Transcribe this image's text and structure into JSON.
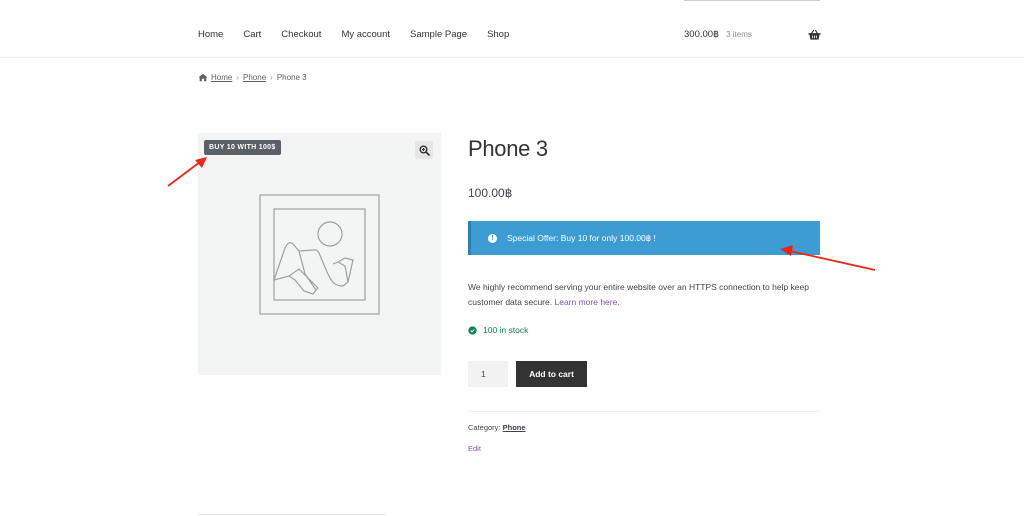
{
  "nav": {
    "items": [
      {
        "label": "Home"
      },
      {
        "label": "Cart"
      },
      {
        "label": "Checkout"
      },
      {
        "label": "My account"
      },
      {
        "label": "Sample Page"
      },
      {
        "label": "Shop"
      }
    ]
  },
  "cart": {
    "total": "300.00฿",
    "count": "3 items",
    "icon": "basket-icon"
  },
  "breadcrumb": {
    "home_icon": "home-icon",
    "home": "Home",
    "category": "Phone",
    "current": "Phone 3",
    "separator": "›"
  },
  "product": {
    "badge": "BUY 10 WITH 100$",
    "zoom_icon": "zoom-in-icon",
    "image_icon": "image-placeholder-icon",
    "title": "Phone 3",
    "price": "100.00฿",
    "offer_icon": "info-icon",
    "offer_text": "Special Offer: Buy 10 for only 100.00฿ !",
    "description": "We highly recommend serving your entire website over an HTTPS connection to help keep customer data secure.",
    "learn_more": "Learn more here.",
    "stock_text": "100 in stock",
    "stock_icon": "check-circle-icon",
    "quantity": "1",
    "add_to_cart": "Add to cart",
    "category_label": "Category:",
    "category_value": "Phone",
    "edit": "Edit"
  },
  "colors": {
    "offer_bg": "#3d9cd2",
    "badge_bg": "#5b5f66",
    "button_bg": "#333333",
    "stock": "#0f834d",
    "link": "#7f54b3",
    "annotation_arrow": "#e8271a"
  }
}
